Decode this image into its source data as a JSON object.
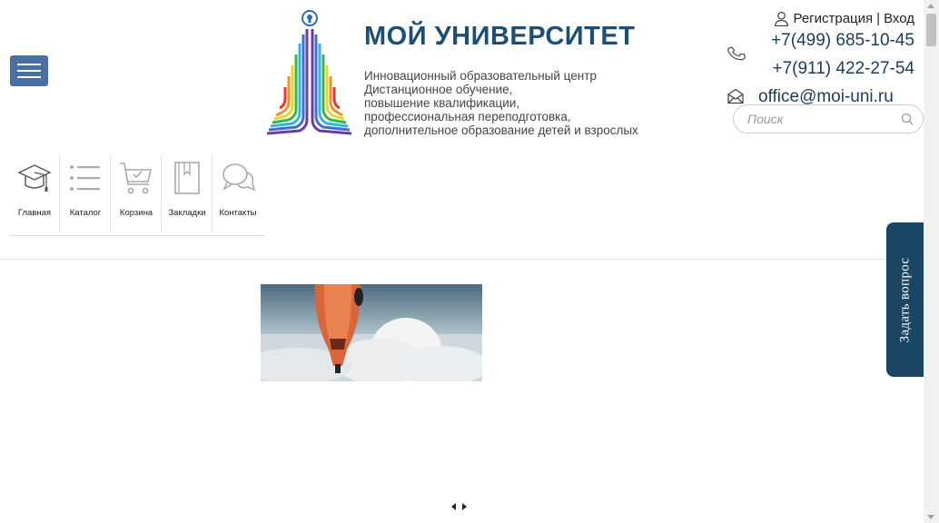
{
  "header": {
    "brand_title": "МОЙ УНИВЕРСИТЕТ",
    "brand_description": [
      "Инновационный образовательный центр",
      "Дистанционное обучение,",
      "повышение квалификации,",
      "профессиональная переподготовка,",
      "дополнительное образование детей и взрослых"
    ],
    "auth": {
      "register": "Регистрация",
      "separator": "|",
      "login": "Вход"
    },
    "phones": [
      "+7(499) 685-10-45",
      "+7(911) 422-27-54"
    ],
    "email": "office@moi-uni.ru",
    "search": {
      "placeholder": "Поиск",
      "value": ""
    },
    "accent_color": "#1d4e75"
  },
  "nav": [
    {
      "label": "Главная",
      "icon": "graduation-cap-icon"
    },
    {
      "label": "Каталог",
      "icon": "list-icon"
    },
    {
      "label": "Корзина",
      "icon": "cart-icon"
    },
    {
      "label": "Закладки",
      "icon": "bookmark-icon"
    },
    {
      "label": "Контакты",
      "icon": "chat-icon"
    }
  ],
  "side_button": {
    "label": "Задать вопрос",
    "color": "#1a4666"
  },
  "menu_button_color": "#4a6fa3"
}
